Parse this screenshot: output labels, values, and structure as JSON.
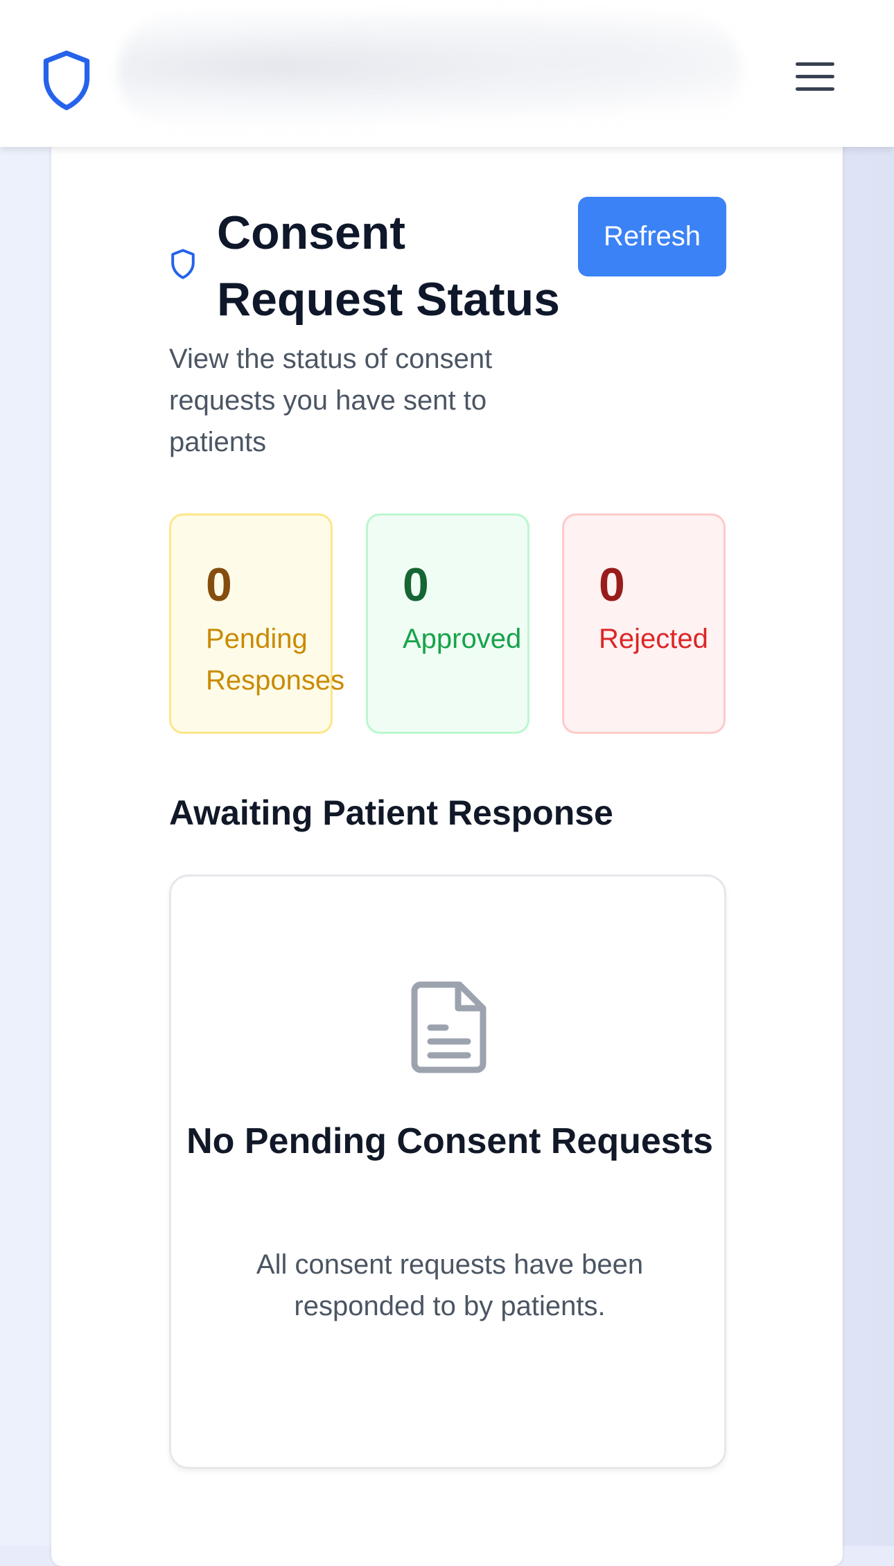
{
  "header": {
    "logo_icon": "shield-icon",
    "menu_icon": "hamburger-menu-icon"
  },
  "page": {
    "title_icon": "shield-icon",
    "title": "Consent Request Status",
    "refresh_label": "Refresh",
    "subtitle": "View the status of consent requests you have sent to patients"
  },
  "stats": {
    "pending": {
      "value": "0",
      "label": "Pending\nResponses"
    },
    "approved": {
      "value": "0",
      "label": "Approved"
    },
    "rejected": {
      "value": "0",
      "label": "Rejected"
    }
  },
  "section": {
    "title": "Awaiting Patient Response"
  },
  "empty_state": {
    "icon": "document-icon",
    "title": "No Pending Consent Requests",
    "description": "All consent requests have been responded to by patients."
  },
  "colors": {
    "accent": "#3b82f6",
    "pending": "#ca8a04",
    "approved": "#16a34a",
    "rejected": "#dc2626"
  }
}
